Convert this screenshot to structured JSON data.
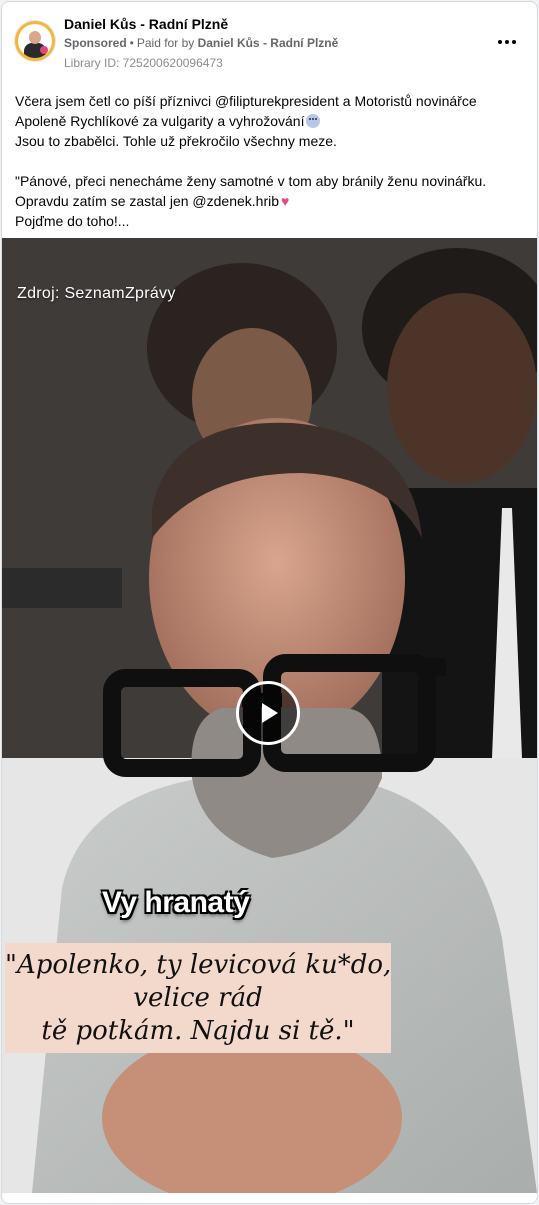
{
  "post": {
    "page_name": "Daniel Kůs - Radní Plzně",
    "sponsored_label": "Sponsored",
    "paid_for_prefix": "Paid for by",
    "payer": "Daniel Kůs - Radní Plzně",
    "library_id": "Library ID: 725200620096473",
    "more_icon": "more-horizontal-icon",
    "text_lines": [
      "Včera jsem četl co píší příznivci @filipturekpresident a Motoristů novinářce",
      "Apoleně Rychlíkové za vulgarity a vyhrožování",
      "Jsou to zbabělci. Tohle už překročilo všechny meze.",
      "\"Pánové, přeci nenecháme ženy samotné v tom aby bránily ženu novinářku.",
      "Opravdu zatím se zastal jen @zdenek.hrib",
      "Pojďme do toho!..."
    ],
    "emoji_1": "face-with-spiral-eyes-icon",
    "emoji_2": "pink-heart-icon"
  },
  "video": {
    "source_label": "Zdroj: SeznamZprávy",
    "caption_speaker": "Vy hranatý",
    "quote_lines": [
      "\"Apolenko, ty levicová ku*do,",
      "velice rád",
      "tě potkám. Najdu si tě.\""
    ],
    "play_icon": "play-icon"
  },
  "colors": {
    "card_bg": "#ffffff",
    "page_bg": "#f0f2f5",
    "secondary_text": "#65676b",
    "quote_box_bg": "#f3d9cc"
  }
}
